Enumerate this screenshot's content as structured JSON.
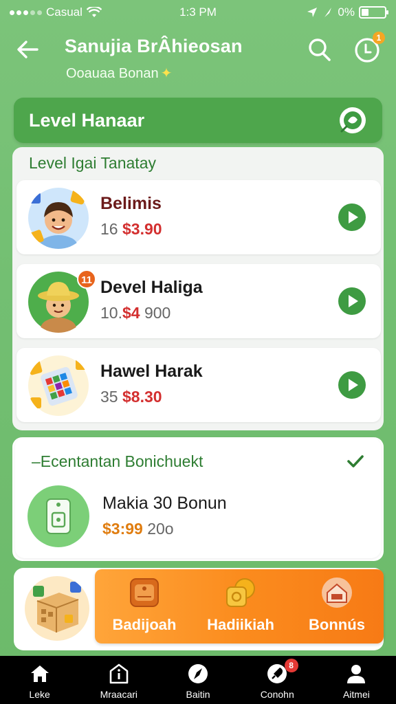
{
  "status_bar": {
    "carrier": "Casual",
    "time": "1:3 PM",
    "battery": "0%"
  },
  "header": {
    "title": "Sanujia BrÂhieosan",
    "subtitle": "Ooauaa Bonan",
    "clock_badge": "1"
  },
  "level_banner": {
    "title": "Level Hanaar"
  },
  "section_levels": {
    "title": "Level Igai Tanatay",
    "items": [
      {
        "name": "Belimis",
        "price_prefix": "16",
        "price": "$3.90"
      },
      {
        "name": "Devel Haliga",
        "price_prefix": "10.",
        "price": "$4",
        "price_suffix": "900",
        "badge": "11"
      },
      {
        "name": "Hawel Harak",
        "price_prefix": "35",
        "price": "$8.30"
      }
    ]
  },
  "section_bonus": {
    "title": "–Ecentantan Bonichuekt",
    "item_name": "Makia 30 Bonun",
    "price": "$3:99",
    "price_suffix": "20o"
  },
  "promo": {
    "items": [
      {
        "label": "Badijoah",
        "icon": "badge-icon"
      },
      {
        "label": "Hadiikiah",
        "icon": "coin-icon"
      },
      {
        "label": "Bonnús",
        "icon": "house-icon"
      }
    ]
  },
  "bottom_nav": {
    "items": [
      {
        "label": "Leke",
        "icon": "home-icon"
      },
      {
        "label": "Mraacari",
        "icon": "info-icon"
      },
      {
        "label": "Baitin",
        "icon": "compass-icon"
      },
      {
        "label": "Conohn",
        "icon": "rocket-icon",
        "badge": "8"
      },
      {
        "label": "Aitmei",
        "icon": "user-icon"
      }
    ]
  },
  "colors": {
    "background": "#74c073",
    "banner": "#4ea64c",
    "play_button": "#3e9b42",
    "price_red": "#d32f2f",
    "promo_orange": "#fb8c1e"
  }
}
